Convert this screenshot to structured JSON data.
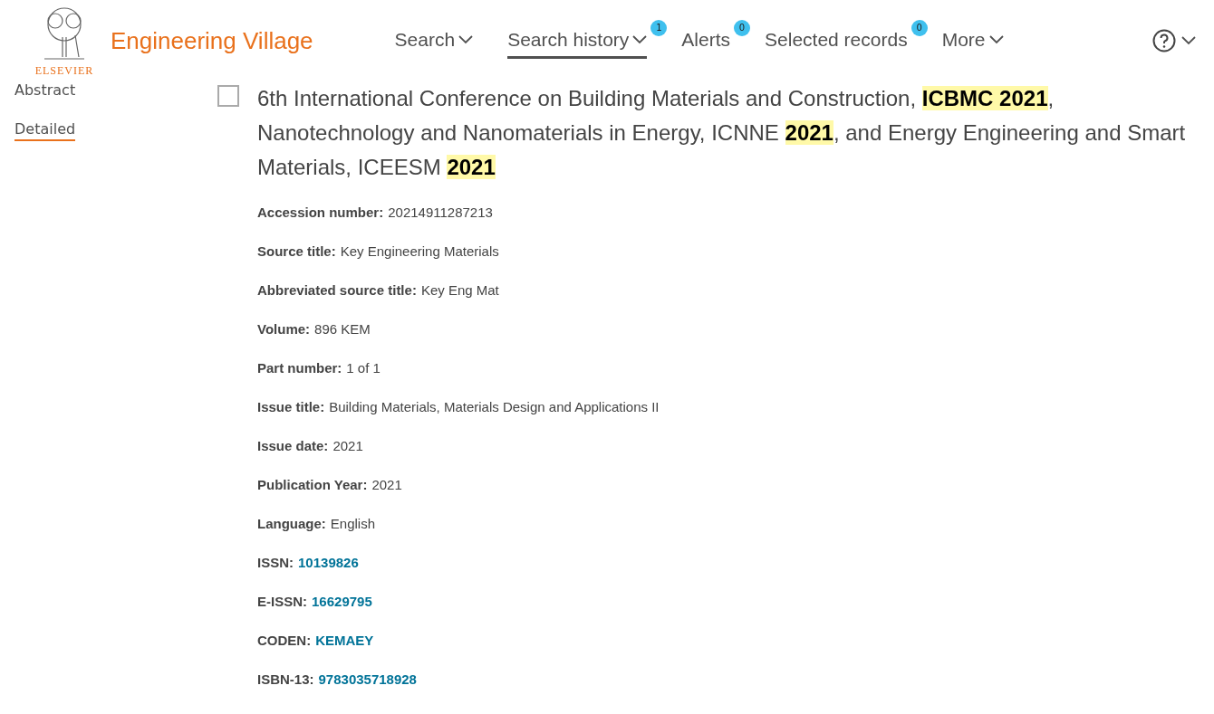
{
  "header": {
    "brand_mark": "ELSEVIER",
    "product": "Engineering Village",
    "nav": [
      {
        "label": "Search",
        "dropdown": true,
        "selected": false
      },
      {
        "label": "Search history",
        "dropdown": true,
        "selected": true,
        "badge": "1"
      },
      {
        "label": "Alerts",
        "dropdown": false,
        "selected": false,
        "badge": "0"
      },
      {
        "label": "Selected records",
        "dropdown": false,
        "selected": false,
        "badge": "0"
      },
      {
        "label": "More",
        "dropdown": true,
        "selected": false
      }
    ]
  },
  "sidebar": {
    "items": [
      {
        "label": "Abstract",
        "selected": false
      },
      {
        "label": "Detailed",
        "selected": true
      }
    ]
  },
  "record": {
    "checked": false,
    "title": "6th International Conference on Building Materials and Construction, **ICBMC 2021**, Nanotechnology and Nanomaterials in Energy, ICNNE **2021**, and Energy Engineering and Smart Materials, ICEESM **2021**",
    "fields": [
      {
        "label": "Accession number:",
        "value": "20214911287213",
        "kind": "text"
      },
      {
        "label": "Source title:",
        "value": "Key Engineering Materials",
        "kind": "text"
      },
      {
        "label": "Abbreviated source title:",
        "value": "Key Eng Mat",
        "kind": "text"
      },
      {
        "label": "Volume:",
        "value": "896 KEM",
        "kind": "text"
      },
      {
        "label": "Part number:",
        "value": "1 of 1",
        "kind": "text"
      },
      {
        "label": "Issue title:",
        "value": "Building Materials, Materials Design and Applications II",
        "kind": "text"
      },
      {
        "label": "Issue date:",
        "value": "2021",
        "kind": "text"
      },
      {
        "label": "Publication Year:",
        "value": "2021",
        "kind": "text"
      },
      {
        "label": "Language:",
        "value": "English",
        "kind": "text"
      },
      {
        "label": "ISSN:",
        "value": "10139826",
        "kind": "link"
      },
      {
        "label": "E-ISSN:",
        "value": "16629795",
        "kind": "link"
      },
      {
        "label": "CODEN:",
        "value": "KEMAEY",
        "kind": "link"
      },
      {
        "label": "ISBN-13:",
        "value": "9783035718928",
        "kind": "link"
      }
    ]
  }
}
